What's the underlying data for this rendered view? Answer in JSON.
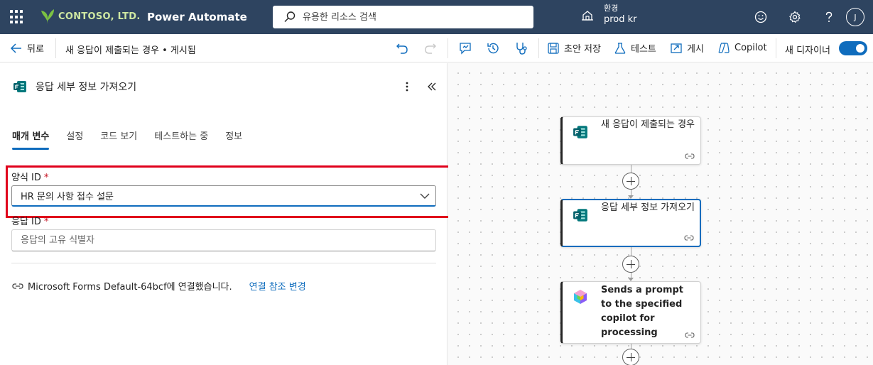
{
  "topbar": {
    "brand": "CONTOSO, LTD.",
    "app_title": "Power Automate",
    "search_placeholder": "유용한 리소스 검색",
    "env_label": "환경",
    "env_value": "prod kr",
    "avatar_initial": "J",
    "bg_color": "#2e4460"
  },
  "cmdbar": {
    "back_label": "뒤로",
    "flow_title": "새 응답이 제출되는 경우 • 게시됨",
    "save_draft": "초안 저장",
    "test": "테스트",
    "publish": "게시",
    "copilot": "Copilot",
    "new_designer": "새 디자이너",
    "new_designer_on": true,
    "accent": "#0f6cbd"
  },
  "panel": {
    "title": "응답 세부 정보 가져오기",
    "tabs": [
      {
        "label": "매개 변수",
        "active": true
      },
      {
        "label": "설정",
        "active": false
      },
      {
        "label": "코드 보기",
        "active": false
      },
      {
        "label": "테스트하는 중",
        "active": false
      },
      {
        "label": "정보",
        "active": false
      }
    ],
    "form_id_label": "양식 ID",
    "form_id_value": "HR 문의 사항 접수 설문",
    "response_id_label": "응답 ID",
    "response_id_placeholder": "응답의 고유 식별자",
    "required_mark": "*",
    "connection_text": "Microsoft Forms Default-64bcf에 연결했습니다.",
    "connection_link": "연결 참조 변경",
    "highlight_color": "#e0001b"
  },
  "canvas": {
    "cards": [
      {
        "text": "새 응답이 제출되는 경우",
        "icon": "forms-icon",
        "selected": false
      },
      {
        "text": "응답 세부 정보 가져오기",
        "icon": "forms-icon",
        "selected": true
      },
      {
        "text": "Sends a prompt to the specified copilot for processing",
        "icon": "copilot-cube-icon",
        "selected": false
      }
    ]
  }
}
